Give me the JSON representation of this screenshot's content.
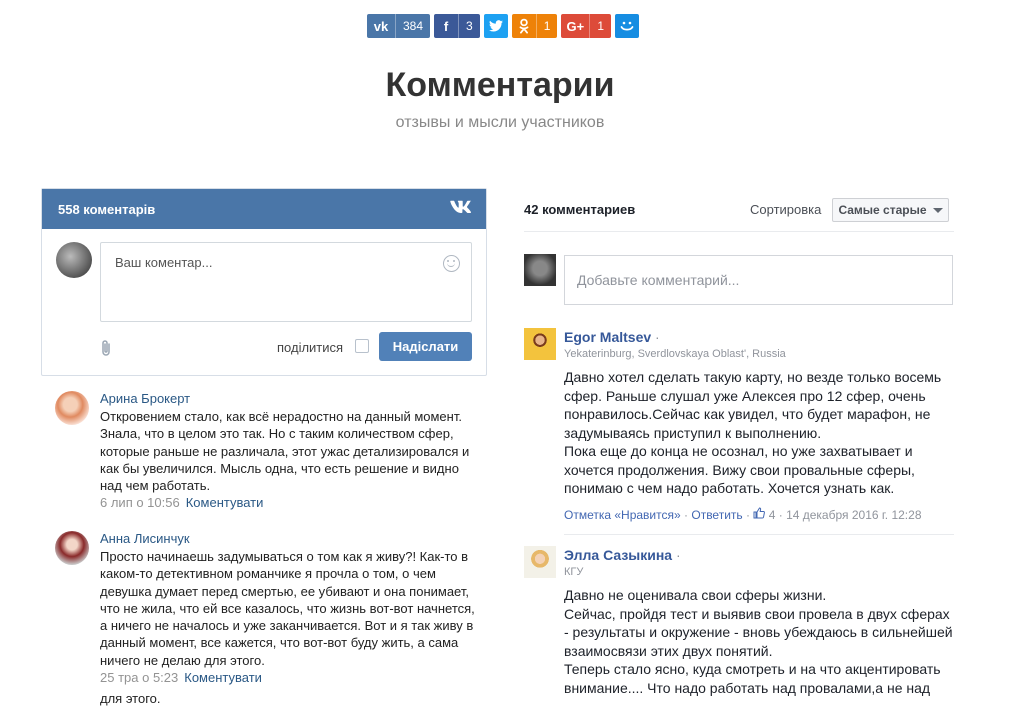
{
  "share": {
    "vk": {
      "icon": "vk-icon",
      "count": "384"
    },
    "facebook": {
      "icon": "facebook-icon",
      "count": "3"
    },
    "twitter": {
      "icon": "twitter-icon"
    },
    "odnoklassniki": {
      "icon": "odnoklassniki-icon",
      "count": "1"
    },
    "googleplus": {
      "icon": "googleplus-icon",
      "label": "G+",
      "count": "1"
    },
    "mailru": {
      "icon": "mailru-icon"
    }
  },
  "header": {
    "title": "Комментарии",
    "subtitle": "отзывы и мысли участников"
  },
  "vk_widget": {
    "count_label": "558 коментарів",
    "logo": "VK",
    "input_placeholder": "Ваш коментар...",
    "share_label": "поділитися",
    "send_label": "Надіслати",
    "comments": [
      {
        "name": "Арина Брокерт",
        "text": "Откровением стало, как всё нерадостно на данный момент. Знала, что в целом это так. Но с таким количеством сфер, которые раньше не различала, этот ужас детализировался и как бы увеличился. Мысль одна, что есть решение и видно над чем работать.",
        "date": "6 лип о 10:56",
        "reply": "Коментувати"
      },
      {
        "name": "Анна Лисинчук",
        "text": "Просто начинаешь задумываться о том как я живу?! Как-то в каком-то детективном романчике я прочла о том, о чем девушка думает перед смертью, ее убивают и она понимает, что не жила, что ей все казалось, что жизнь вот-вот начнется, а ничего не началось и уже заканчивается. Вот и я так живу в данный момент, все кажется, что вот-вот буду жить, а сама ничего не делаю для этого.",
        "date": "25 тра о 5:23",
        "reply": "Коментувати"
      }
    ],
    "overflow_text": "для этого."
  },
  "fb_widget": {
    "count_label": "42 комментариев",
    "sort_label": "Сортировка",
    "sort_value": "Самые старые",
    "input_placeholder": "Добавьте комментарий...",
    "comments": [
      {
        "name": "Egor Maltsev",
        "location": "Yekaterinburg, Sverdlovskaya Oblast', Russia",
        "text": "Давно хотел сделать такую карту, но везде только восемь сфер. Раньше слушал уже Алексея про 12 сфер, очень понравилось.Сейчас как увидел, что будет марафон, не задумываясь приступил к выполнению.\nПока еще до конца не осознал, но уже захватывает и хочется продолжения. Вижу свои провальные сферы, понимаю с чем надо работать. Хочется узнать как.",
        "like_action": "Отметка «Нравится»",
        "reply_action": "Ответить",
        "likes": "4",
        "date": "14 декабря 2016 г. 12:28"
      },
      {
        "name": "Элла Сазыкина",
        "location": "КГУ",
        "text": "Давно не оценивала свои сферы жизни.\nСейчас, пройдя тест и выявив свои провела в двух сферах - результаты и окружение - вновь убеждаюсь в сильнейшей взаимосвязи этих двух понятий.\nТеперь стало ясно, куда смотреть и на что акцентировать внимание.... Что надо работать над провалами,а не над"
      }
    ]
  }
}
